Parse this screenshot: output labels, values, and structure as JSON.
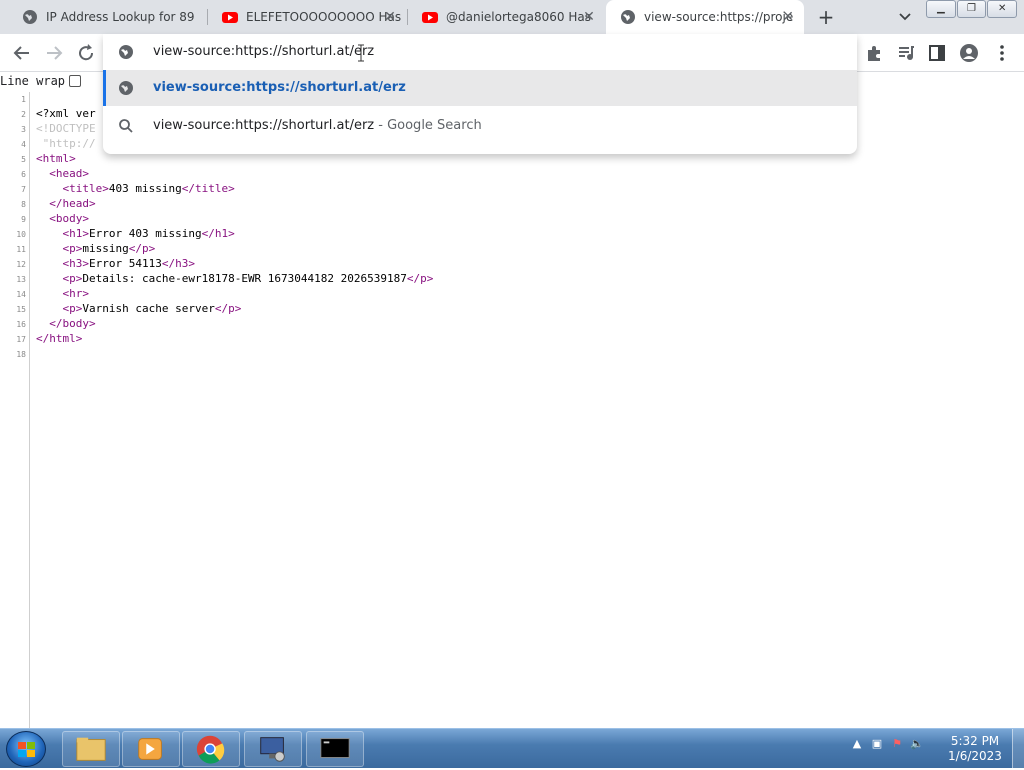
{
  "tabs": [
    {
      "title": "IP Address Lookup for 89",
      "icon": "globe-icon"
    },
    {
      "title": "ELEFETOOOOOOOOO Has",
      "icon": "youtube-icon"
    },
    {
      "title": "@danielortega8060 Has",
      "icon": "youtube-icon"
    },
    {
      "title": "view-source:https://proje",
      "icon": "globe-icon"
    }
  ],
  "omnibox": {
    "input": "view-source:https://shorturl.at/erz",
    "suggestions": [
      {
        "text": "view-source:https://shorturl.at/erz",
        "suffix": ""
      },
      {
        "text": "view-source:https://shorturl.at/erz",
        "suffix": " - Google Search"
      }
    ]
  },
  "viewsource": {
    "line_wrap_label": "Line wrap",
    "line_wrap_checked": false,
    "lines": [
      "",
      "<?xml ver",
      "<!DOCTYPE",
      " \"http://",
      "<html>",
      "  <head>",
      "    <title>403 missing</title>",
      "  </head>",
      "  <body>",
      "    <h1>Error 403 missing</h1>",
      "    <p>missing</p>",
      "    <h3>Error 54113</h3>",
      "    <p>Details: cache-ewr18178-EWR 1673044182 2026539187</p>",
      "    <hr>",
      "    <p>Varnish cache server</p>",
      "  </body>",
      "</html>",
      ""
    ]
  },
  "taskbar": {
    "time": "5:32 PM",
    "date": "1/6/2023"
  },
  "colors": {
    "accent": "#1a73e8",
    "tag": "#881280",
    "tabstrip": "#dee1e6"
  }
}
